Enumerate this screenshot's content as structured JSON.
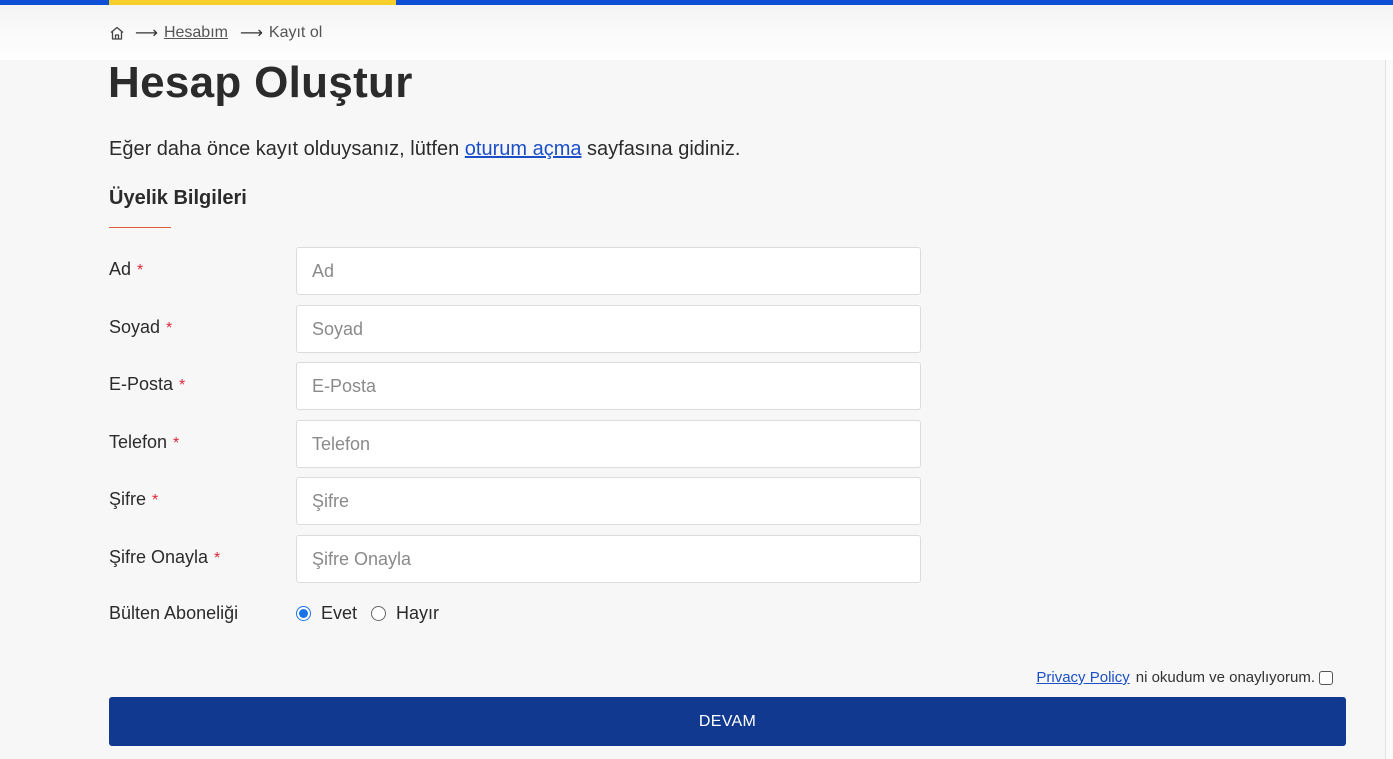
{
  "breadcrumb": {
    "home_icon": "home-icon",
    "arrow": "⟶",
    "account": "Hesabım",
    "current": "Kayıt ol"
  },
  "page": {
    "title": "Hesap Oluştur",
    "intro_before": "Eğer daha önce kayıt olduysanız, lütfen ",
    "intro_link": "oturum açma",
    "intro_after": " sayfasına gidiniz.",
    "section_title": "Üyelik Bilgileri"
  },
  "form": {
    "required_mark": "*",
    "fields": [
      {
        "label": "Ad",
        "placeholder": "Ad",
        "value": ""
      },
      {
        "label": "Soyad",
        "placeholder": "Soyad",
        "value": ""
      },
      {
        "label": "E-Posta",
        "placeholder": "E-Posta",
        "value": ""
      },
      {
        "label": "Telefon",
        "placeholder": "Telefon",
        "value": ""
      },
      {
        "label": "Şifre",
        "placeholder": "Şifre",
        "value": ""
      },
      {
        "label": "Şifre Onayla",
        "placeholder": "Şifre Onayla",
        "value": ""
      }
    ],
    "newsletter": {
      "label": "Bülten Aboneliği",
      "option_yes": "Evet",
      "option_no": "Hayır",
      "selected": "Evet"
    },
    "privacy_link": "Privacy Policy",
    "privacy_text": "ni okudum ve onaylıyorum.",
    "privacy_checked": false,
    "submit_label": "DEVAM"
  },
  "colors": {
    "top_bar": "#0d4fd6",
    "top_bar_accent": "#f6cf2a",
    "link": "#1b4fc8",
    "required": "#e0283a",
    "button": "#10398f",
    "section_underline": "#e05a3a"
  }
}
